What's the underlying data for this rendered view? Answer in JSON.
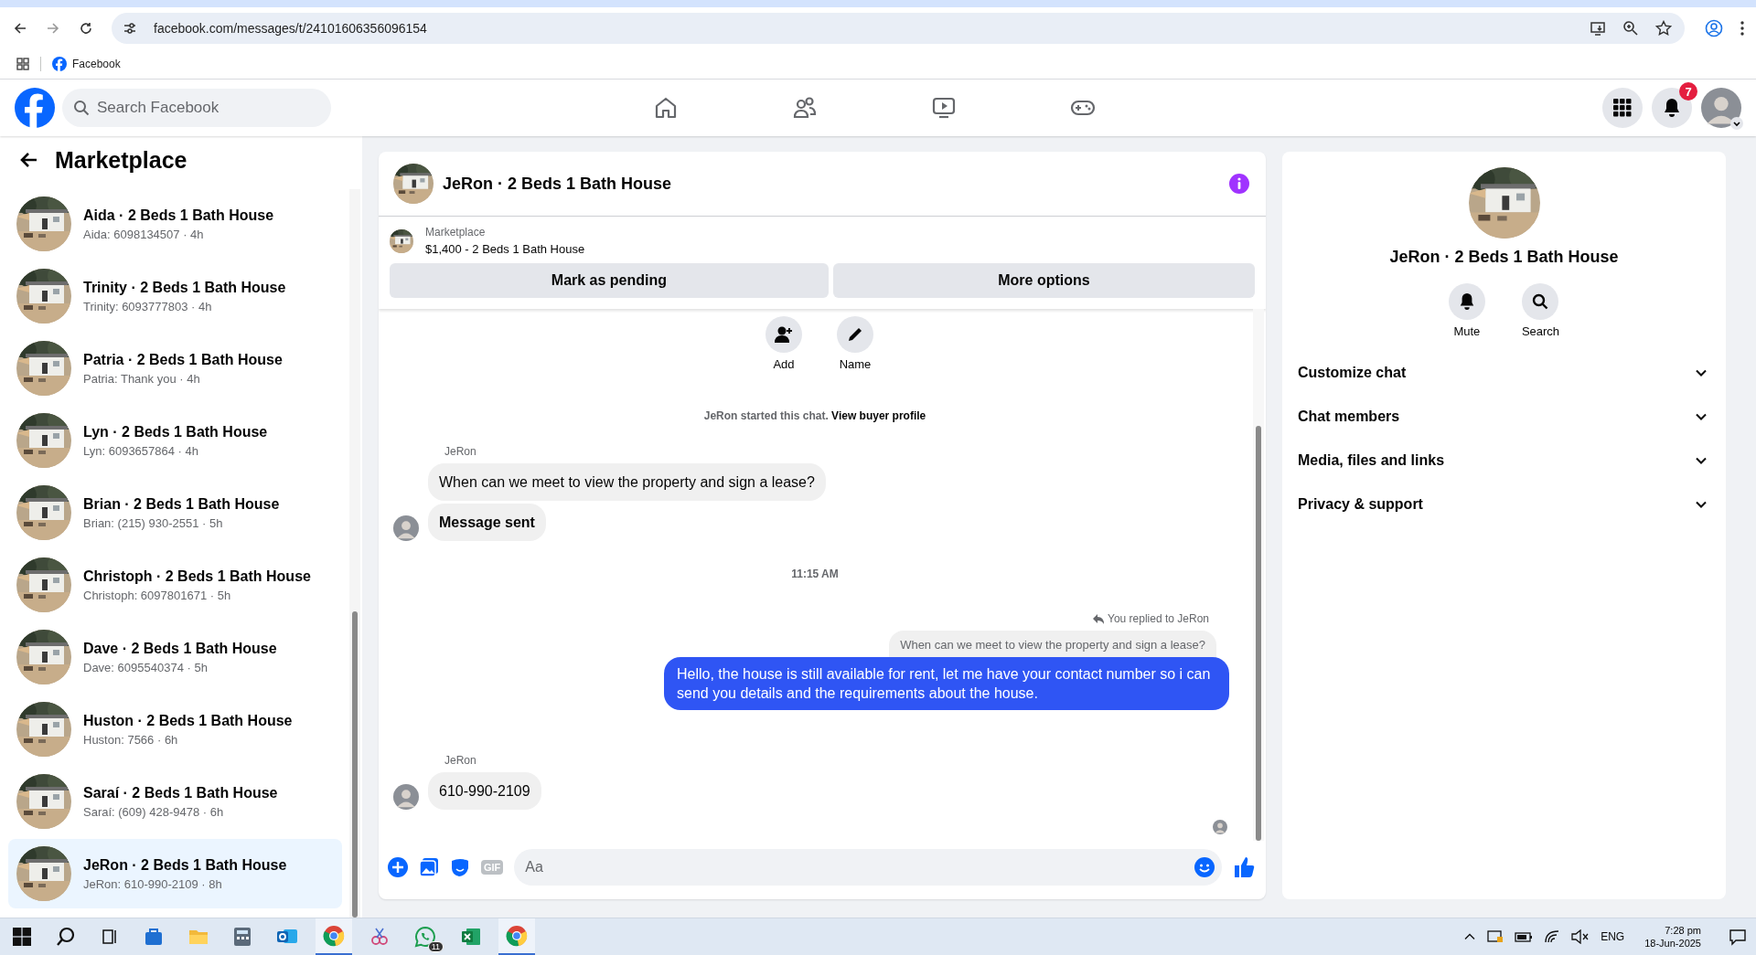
{
  "browser": {
    "url": "facebook.com/messages/t/24101606356096154",
    "bookmarks": [
      {
        "label": "Facebook"
      }
    ]
  },
  "header": {
    "search_placeholder": "Search Facebook",
    "notification_count": "7"
  },
  "sidebar": {
    "title": "Marketplace",
    "conversations": [
      {
        "title": "Aida · 2 Beds 1 Bath House",
        "preview": "Aida: 6098134507 · 4h",
        "selected": false
      },
      {
        "title": "Trinity · 2 Beds 1 Bath House",
        "preview": "Trinity: 6093777803 · 4h",
        "selected": false
      },
      {
        "title": "Patria · 2 Beds 1 Bath House",
        "preview": "Patria: Thank you · 4h",
        "selected": false
      },
      {
        "title": "Lyn · 2 Beds 1 Bath House",
        "preview": "Lyn: 6093657864 · 4h",
        "selected": false
      },
      {
        "title": "Brian · 2 Beds 1 Bath House",
        "preview": "Brian: (215) 930-2551 · 5h",
        "selected": false
      },
      {
        "title": "Christoph · 2 Beds 1 Bath House",
        "preview": "Christoph: 6097801671 · 5h",
        "selected": false
      },
      {
        "title": "Dave · 2 Beds 1 Bath House",
        "preview": "Dave: 6095540374 · 5h",
        "selected": false
      },
      {
        "title": "Huston · 2 Beds 1 Bath House",
        "preview": "Huston: 7566 · 6h",
        "selected": false
      },
      {
        "title": "Saraí · 2 Beds 1 Bath House",
        "preview": "Saraí: (609) 428-9478 · 6h",
        "selected": false
      },
      {
        "title": "JeRon · 2 Beds 1 Bath House",
        "preview": "JeRon: 610-990-2109 · 8h",
        "selected": true
      }
    ]
  },
  "chat": {
    "title": "JeRon · 2 Beds 1 Bath House",
    "listing": {
      "source": "Marketplace",
      "title": "$1,400 - 2 Beds 1 Bath House"
    },
    "actions": [
      "Mark as pending",
      "More options"
    ],
    "quick_actions": [
      {
        "kind": "add",
        "label": "Add"
      },
      {
        "kind": "name",
        "label": "Name"
      }
    ],
    "started": {
      "text": "JeRon started this chat.",
      "link": "View buyer profile"
    },
    "messages": [
      {
        "kind": "sender",
        "text": "JeRon"
      },
      {
        "kind": "incoming",
        "text": "When can we meet to view the property and sign a lease?",
        "avatar": false
      },
      {
        "kind": "incoming",
        "text": "**Message sent**",
        "avatar": true
      },
      {
        "kind": "timestamp",
        "text": "11:15 AM"
      },
      {
        "kind": "reply_note",
        "text": "You replied to JeRon"
      },
      {
        "kind": "quoted",
        "text": "When can we meet to view the property and sign a lease?"
      },
      {
        "kind": "outgoing",
        "text": "Hello, the house is still available for rent, let me have your contact number so i can send you details and the requirements about the house."
      },
      {
        "kind": "sender",
        "text": "JeRon"
      },
      {
        "kind": "incoming",
        "text": "610-990-2109",
        "avatar": true
      },
      {
        "kind": "seen"
      }
    ],
    "composer": {
      "gif_label": "GIF",
      "placeholder": "Aa"
    }
  },
  "details": {
    "title": "JeRon · 2 Beds 1 Bath House",
    "actions": [
      {
        "kind": "mute",
        "label": "Mute"
      },
      {
        "kind": "search",
        "label": "Search"
      }
    ],
    "sections": [
      {
        "label": "Customize chat",
        "expanded": false
      },
      {
        "label": "Chat members",
        "expanded": false
      },
      {
        "label": "Media, files and links",
        "expanded": false
      },
      {
        "label": "Privacy & support",
        "expanded": false
      }
    ]
  },
  "taskbar": {
    "whatsapp_badge": "11",
    "language": "ENG",
    "time": "7:28 pm",
    "date": "18-Jun-2025"
  }
}
